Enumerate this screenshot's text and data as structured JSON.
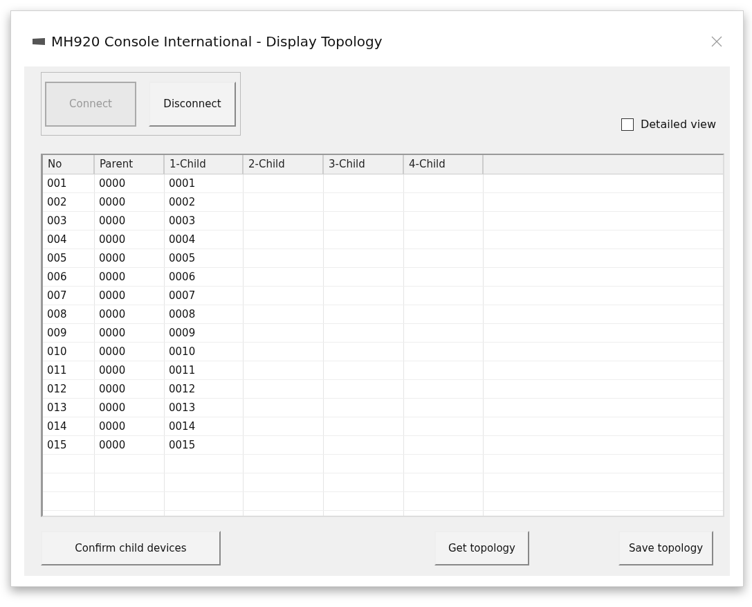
{
  "window": {
    "title": "MH920 Console International - Display Topology"
  },
  "connection_buttons": [
    {
      "label": "Connect",
      "disabled": true
    },
    {
      "label": "Disconnect",
      "disabled": false
    }
  ],
  "detailed_view": {
    "label": "Detailed view",
    "checked": false
  },
  "table": {
    "columns": [
      "No",
      "Parent",
      "1-Child",
      "2-Child",
      "3-Child",
      "4-Child"
    ],
    "rows": [
      {
        "no": "001",
        "parent": "0000",
        "child_1": "0001"
      },
      {
        "no": "002",
        "parent": "0000",
        "child_1": "0002"
      },
      {
        "no": "003",
        "parent": "0000",
        "child_1": "0003"
      },
      {
        "no": "004",
        "parent": "0000",
        "child_1": "0004"
      },
      {
        "no": "005",
        "parent": "0000",
        "child_1": "0005"
      },
      {
        "no": "006",
        "parent": "0000",
        "child_1": "0006"
      },
      {
        "no": "007",
        "parent": "0000",
        "child_1": "0007"
      },
      {
        "no": "008",
        "parent": "0000",
        "child_1": "0008"
      },
      {
        "no": "009",
        "parent": "0000",
        "child_1": "0009"
      },
      {
        "no": "010",
        "parent": "0000",
        "child_1": "0010"
      },
      {
        "no": "011",
        "parent": "0000",
        "child_1": "0011"
      },
      {
        "no": "012",
        "parent": "0000",
        "child_1": "0012"
      },
      {
        "no": "013",
        "parent": "0000",
        "child_1": "0013"
      },
      {
        "no": "014",
        "parent": "0000",
        "child_1": "0014"
      },
      {
        "no": "015",
        "parent": "0000",
        "child_1": "0015"
      }
    ]
  },
  "bottom_buttons": [
    "Confirm child devices",
    "Get topology",
    "Save topology"
  ]
}
